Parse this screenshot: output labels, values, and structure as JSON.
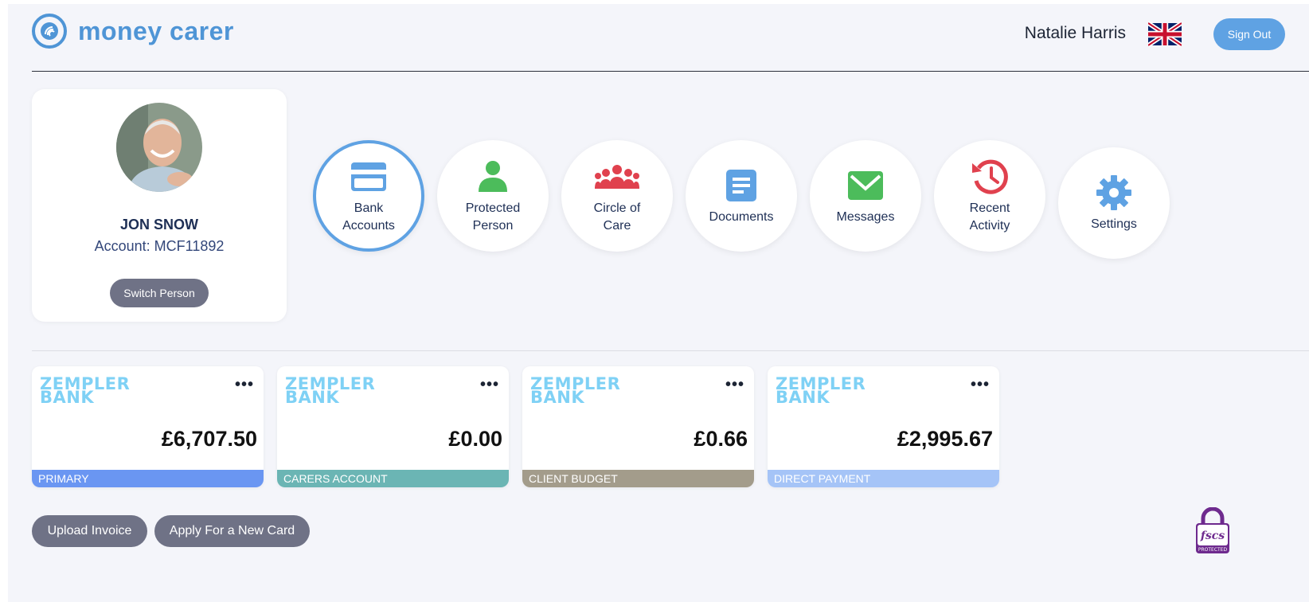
{
  "header": {
    "logo_text": "money carer",
    "user_name": "Natalie Harris",
    "sign_out_label": "Sign Out"
  },
  "profile": {
    "name": "JON SNOW",
    "account": "Account: MCF11892",
    "switch_label": "Switch Person"
  },
  "nav": [
    {
      "label_1": "Bank",
      "label_2": "Accounts",
      "icon": "credit-card-icon",
      "color": "#5fa2e3",
      "active": true
    },
    {
      "label_1": "Protected",
      "label_2": "Person",
      "icon": "person-icon",
      "color": "#4cbc5b"
    },
    {
      "label_1": "Circle of",
      "label_2": "Care",
      "icon": "group-icon",
      "color": "#e0414e"
    },
    {
      "label_1": "Documents",
      "icon": "document-icon",
      "color": "#5fa2e3"
    },
    {
      "label_1": "Messages",
      "icon": "envelope-icon",
      "color": "#4cbc5b"
    },
    {
      "label_1": "Recent",
      "label_2": "Activity",
      "icon": "history-icon",
      "color": "#e0414e"
    },
    {
      "label_1": "Settings",
      "icon": "gear-icon",
      "color": "#5fa2e3"
    }
  ],
  "cards": [
    {
      "bank_line1": "ZEMPLER",
      "bank_line2": "BANK",
      "amount": "£6,707.50",
      "label": "PRIMARY",
      "color": "#6a96f2"
    },
    {
      "bank_line1": "ZEMPLER",
      "bank_line2": "BANK",
      "amount": "£0.00",
      "label": "CARERS ACCOUNT",
      "color": "#6bb5b4"
    },
    {
      "bank_line1": "ZEMPLER",
      "bank_line2": "BANK",
      "amount": "£0.66",
      "label": "CLIENT BUDGET",
      "color": "#a39c8b"
    },
    {
      "bank_line1": "ZEMPLER",
      "bank_line2": "BANK",
      "amount": "£2,995.67",
      "label": "DIRECT PAYMENT",
      "color": "#a5c4f7"
    }
  ],
  "actions": {
    "upload_invoice": "Upload Invoice",
    "apply_card": "Apply For a New Card"
  },
  "badge": {
    "line1": "fscs",
    "line2": "PROTECTED"
  }
}
